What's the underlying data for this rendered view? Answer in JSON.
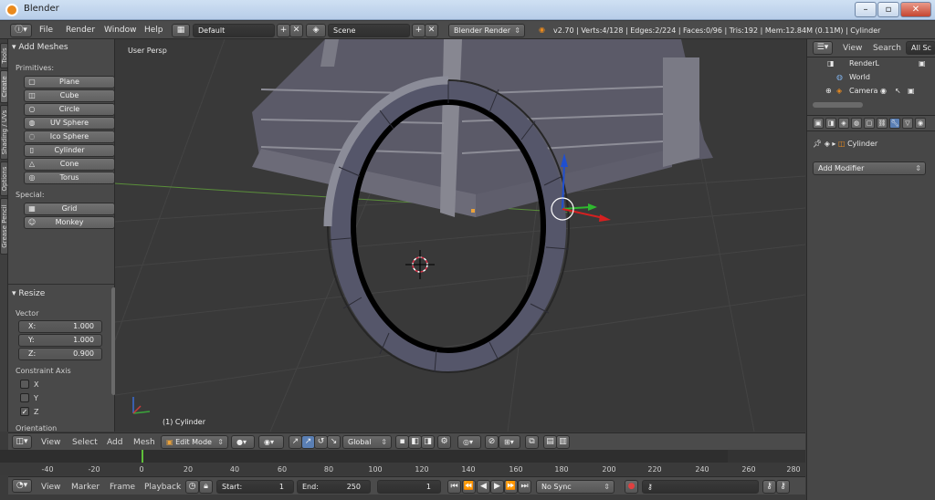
{
  "window": {
    "title": "Blender"
  },
  "info": {
    "menus": [
      "File",
      "Render",
      "Window",
      "Help"
    ],
    "layout": "Default",
    "scene": "Scene",
    "engine": "Blender Render",
    "stats": "v2.70 | Verts:4/128 | Edges:2/224 | Faces:0/96 | Tris:192 | Mem:12.84M (0.11M) | Cylinder"
  },
  "left_tabs": [
    "Tools",
    "Create",
    "Shading / UVs",
    "Options",
    "Grease Pencil"
  ],
  "tools": {
    "header": "Add Meshes",
    "primitives_label": "Primitives:",
    "primitives": [
      "Plane",
      "Cube",
      "Circle",
      "UV Sphere",
      "Ico Sphere",
      "Cylinder",
      "Cone",
      "Torus"
    ],
    "special_label": "Special:",
    "special": [
      "Grid",
      "Monkey"
    ]
  },
  "operator": {
    "header": "Resize",
    "vector_label": "Vector",
    "fields": [
      {
        "label": "X:",
        "value": "1.000"
      },
      {
        "label": "Y:",
        "value": "1.000"
      },
      {
        "label": "Z:",
        "value": "0.900"
      }
    ],
    "constraint_label": "Constraint Axis",
    "constraints": [
      {
        "label": "X",
        "checked": false
      },
      {
        "label": "Y",
        "checked": false
      },
      {
        "label": "Z",
        "checked": true
      }
    ],
    "orientation_label": "Orientation"
  },
  "viewport": {
    "persp_label": "User Persp",
    "object_label": "(1) Cylinder"
  },
  "view_header": {
    "menus": [
      "View",
      "Select",
      "Add",
      "Mesh"
    ],
    "mode": "Edit Mode",
    "orientation": "Global"
  },
  "timeline": {
    "ticks": [
      "-40",
      "-20",
      "0",
      "20",
      "40",
      "60",
      "80",
      "100",
      "120",
      "140",
      "160",
      "180",
      "200",
      "220",
      "240",
      "260",
      "280"
    ],
    "menus": [
      "View",
      "Marker",
      "Frame",
      "Playback"
    ],
    "start_label": "Start:",
    "start": "1",
    "end_label": "End:",
    "end": "250",
    "current": "1",
    "sync": "No Sync"
  },
  "outliner": {
    "menus": [
      "View",
      "Search"
    ],
    "filter": "All Sc",
    "rows": [
      "RenderL",
      "World",
      "Camera"
    ]
  },
  "properties": {
    "object": "Cylinder",
    "add_modifier": "Add Modifier"
  }
}
